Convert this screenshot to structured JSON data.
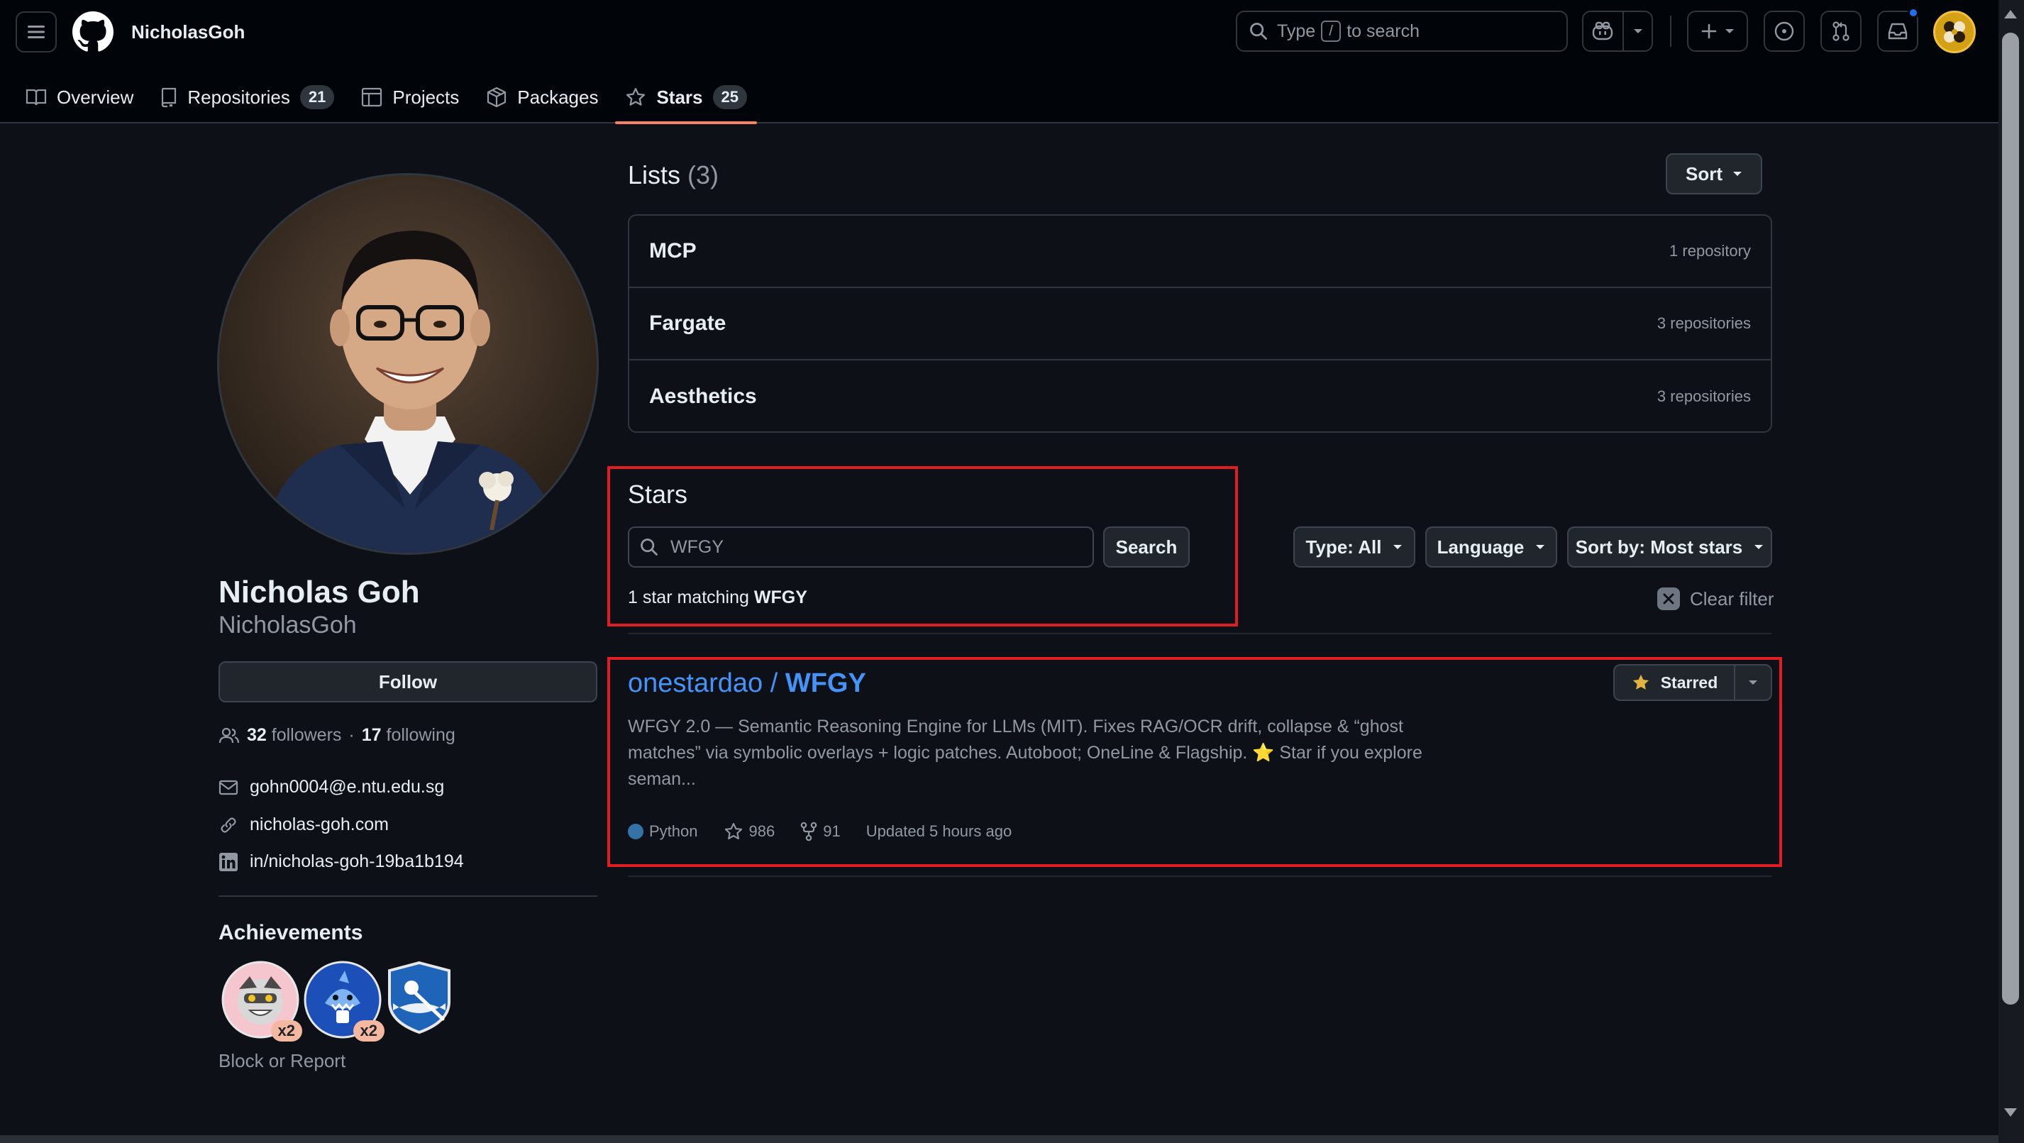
{
  "header": {
    "username": "NicholasGoh",
    "search_placeholder_prefix": "Type",
    "search_key": "/",
    "search_placeholder_suffix": "to search"
  },
  "tabs": [
    {
      "label": "Overview",
      "count": null
    },
    {
      "label": "Repositories",
      "count": "21"
    },
    {
      "label": "Projects",
      "count": null
    },
    {
      "label": "Packages",
      "count": null
    },
    {
      "label": "Stars",
      "count": "25",
      "active": true
    }
  ],
  "profile": {
    "name": "Nicholas Goh",
    "login": "NicholasGoh",
    "follow_label": "Follow",
    "followers_count": "32",
    "followers_label": "followers",
    "dot": "·",
    "following_count": "17",
    "following_label": "following",
    "email": "gohn0004@e.ntu.edu.sg",
    "website": "nicholas-goh.com",
    "linkedin": "in/nicholas-goh-19ba1b194",
    "achievements_title": "Achievements",
    "achievement_badges": [
      {
        "icon": "pull-shark-icon",
        "multiplier": "x2"
      },
      {
        "icon": "shark-icon",
        "multiplier": "x2"
      },
      {
        "icon": "starstruck-icon",
        "multiplier": null
      }
    ],
    "block_report": "Block or Report"
  },
  "lists": {
    "title": "Lists",
    "count": "(3)",
    "sort_label": "Sort",
    "items": [
      {
        "name": "MCP",
        "count": "1 repository"
      },
      {
        "name": "Fargate",
        "count": "3 repositories"
      },
      {
        "name": "Aesthetics",
        "count": "3 repositories"
      }
    ]
  },
  "stars": {
    "title": "Stars",
    "search_value": "WFGY",
    "search_button": "Search",
    "match_prefix": "1 star matching",
    "match_term": "WFGY",
    "filters": {
      "type": "Type: All",
      "language": "Language",
      "sort": "Sort by: Most stars"
    },
    "clear_filter": "Clear filter"
  },
  "repo": {
    "owner": "onestardao",
    "slash": " / ",
    "name": "WFGY",
    "starred_label": "Starred",
    "description_line1": "WFGY 2.0 — Semantic Reasoning Engine for LLMs (MIT). Fixes RAG/OCR drift, collapse & “ghost",
    "description_line2": "matches” via symbolic overlays + logic patches. Autoboot; OneLine & Flagship. ⭐ Star if you explore",
    "description_line3": "seman...",
    "language": "Python",
    "language_color": "#3572a5",
    "stars": "986",
    "forks": "91",
    "updated": "Updated 5 hours ago"
  },
  "colors": {
    "background": "#0d1117",
    "header_bg": "#010409",
    "link": "#4493f8",
    "active_tab_underline": "#f78166",
    "highlight_box": "#e11d24",
    "star_yellow": "#e3b341"
  }
}
